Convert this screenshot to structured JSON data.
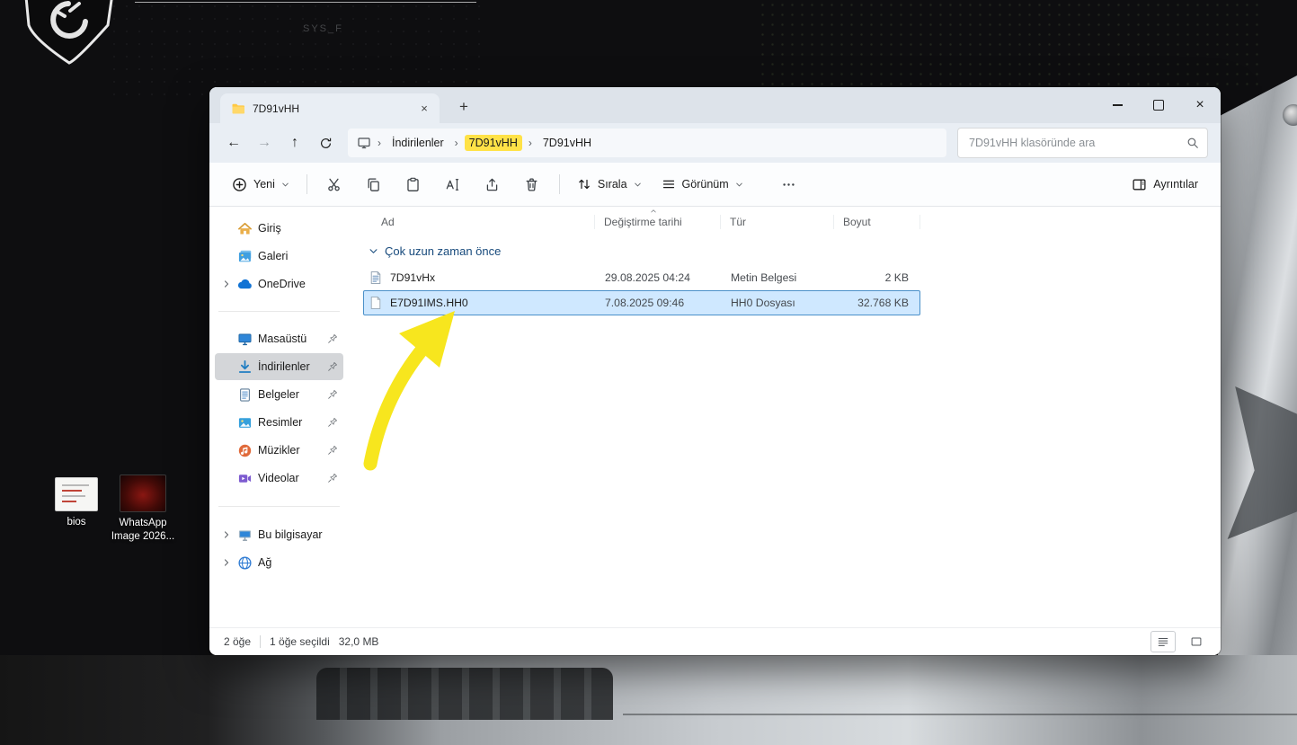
{
  "desktop": {
    "background_text": "SYS_F",
    "icons": [
      {
        "label": "bios"
      },
      {
        "label": "WhatsApp Image 2026..."
      }
    ]
  },
  "glyphs": {
    "back": "←",
    "forward": "→",
    "up": "↑",
    "tab_close": "×",
    "new_tab": "+",
    "close": "×",
    "breadcrumb_separator": "›"
  },
  "window": {
    "tab_title": "7D91vHH",
    "breadcrumb": {
      "items": [
        {
          "label": "İndirilenler"
        },
        {
          "label": "7D91vHH"
        },
        {
          "label": "7D91vHH"
        }
      ]
    },
    "search_placeholder": "7D91vHH klasöründe ara",
    "toolbar": {
      "new_label": "Yeni",
      "sort_label": "Sırala",
      "view_label": "Görünüm",
      "details_label": "Ayrıntılar"
    },
    "sidebar": {
      "items": [
        {
          "label": "Giriş"
        },
        {
          "label": "Galeri"
        },
        {
          "label": "OneDrive"
        },
        {
          "label": "Masaüstü"
        },
        {
          "label": "İndirilenler"
        },
        {
          "label": "Belgeler"
        },
        {
          "label": "Resimler"
        },
        {
          "label": "Müzikler"
        },
        {
          "label": "Videolar"
        },
        {
          "label": "Bu bilgisayar"
        },
        {
          "label": "Ağ"
        }
      ]
    },
    "filelist": {
      "columns": [
        "Ad",
        "Değiştirme tarihi",
        "Tür",
        "Boyut"
      ],
      "group_label": "Çok uzun zaman önce",
      "files": [
        {
          "name": "7D91vHx",
          "modified": "29.08.2025 04:24",
          "type": "Metin Belgesi",
          "size": "2 KB"
        },
        {
          "name": "E7D91IMS.HH0",
          "modified": "7.08.2025 09:46",
          "type": "HH0 Dosyası",
          "size": "32.768 KB"
        }
      ]
    },
    "statusbar": {
      "item_count": "2 öğe",
      "selection": "1 öğe seçildi",
      "selection_size": "32,0 MB"
    }
  }
}
